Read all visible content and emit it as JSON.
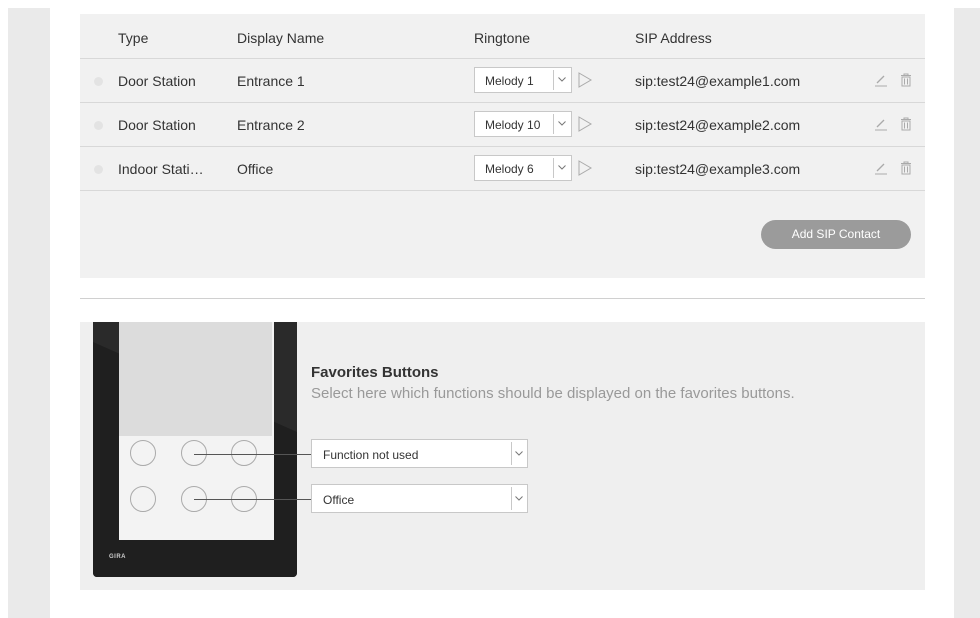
{
  "contacts_table": {
    "headers": {
      "type": "Type",
      "display_name": "Display Name",
      "ringtone": "Ringtone",
      "sip_address": "SIP Address"
    },
    "rows": [
      {
        "type": "Door Station",
        "display_name": "Entrance 1",
        "ringtone": "Melody 1",
        "sip_address": "sip:test24@example1.com"
      },
      {
        "type": "Door Station",
        "display_name": "Entrance 2",
        "ringtone": "Melody 10",
        "sip_address": "sip:test24@example2.com"
      },
      {
        "type": "Indoor Stati…",
        "display_name": "Office",
        "ringtone": "Melody 6",
        "sip_address": "sip:test24@example3.com"
      }
    ],
    "add_button_label": "Add SIP Contact"
  },
  "favorites": {
    "title": "Favorites Buttons",
    "description": "Select here which functions should be displayed on the favorites buttons.",
    "selects": [
      "Function not used",
      "Office"
    ],
    "device_logo": "GIRA"
  },
  "icons": {
    "ringtone_dropdown": "chevron-down-icon",
    "ringtone_play": "play-icon",
    "row_edit": "pencil-icon",
    "row_delete": "trash-icon",
    "favorites_dropdown": "chevron-down-icon"
  },
  "colors": {
    "panel_background": "#f1f1f1",
    "button_background": "#9b9b9b",
    "device_body": "#2a2a2a",
    "secondary_text": "#999999"
  }
}
